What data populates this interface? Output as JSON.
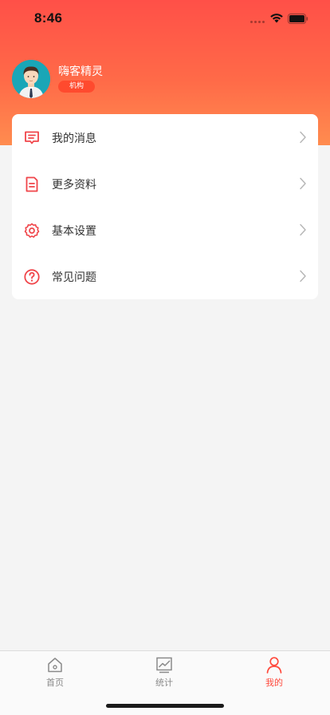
{
  "status_bar": {
    "time": "8:46"
  },
  "profile": {
    "name": "嗨客精灵",
    "role": "机构"
  },
  "menu": {
    "items": [
      {
        "label": "我的消息",
        "icon": "message-icon"
      },
      {
        "label": "更多资料",
        "icon": "document-icon"
      },
      {
        "label": "基本设置",
        "icon": "gear-icon"
      },
      {
        "label": "常见问题",
        "icon": "help-icon"
      }
    ]
  },
  "tab_bar": {
    "items": [
      {
        "label": "首页",
        "icon": "home-icon",
        "active": false
      },
      {
        "label": "统计",
        "icon": "chart-icon",
        "active": false
      },
      {
        "label": "我的",
        "icon": "user-icon",
        "active": true
      }
    ]
  },
  "colors": {
    "accent": "#ff4a3d",
    "header_gradient_top": "#ff5048",
    "header_gradient_bottom": "#ff8c4f",
    "background": "#f4f4f4"
  }
}
